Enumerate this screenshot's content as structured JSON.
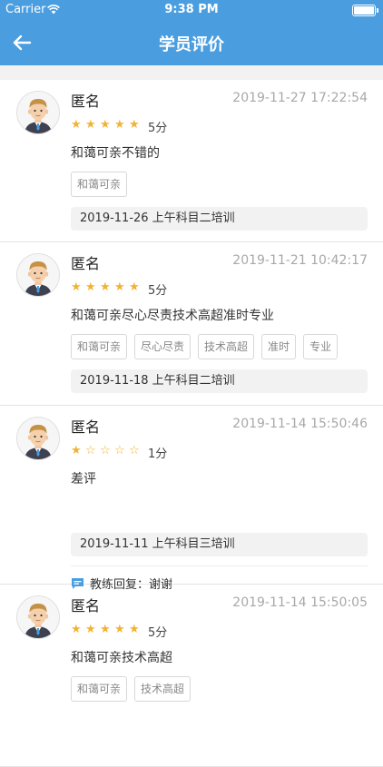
{
  "status_bar": {
    "carrier": "Carrier",
    "time": "9:38 PM"
  },
  "nav": {
    "title": "学员评价"
  },
  "reviews": [
    {
      "name": "匿名",
      "date": "2019-11-27 17:22:54",
      "rating": 5,
      "score_label": "5分",
      "comment": "和蔼可亲不错的",
      "tags": [
        "和蔼可亲"
      ],
      "session": "2019-11-26 上午科目二培训",
      "reply": null
    },
    {
      "name": "匿名",
      "date": "2019-11-21 10:42:17",
      "rating": 5,
      "score_label": "5分",
      "comment": "和蔼可亲尽心尽责技术高超准时专业",
      "tags": [
        "和蔼可亲",
        "尽心尽责",
        "技术高超",
        "准时",
        "专业"
      ],
      "session": "2019-11-18 上午科目二培训",
      "reply": null
    },
    {
      "name": "匿名",
      "date": "2019-11-14 15:50:46",
      "rating": 1,
      "score_label": "1分",
      "comment": "差评",
      "tags": [],
      "session": "2019-11-11 上午科目三培训",
      "reply": "教练回复：谢谢"
    },
    {
      "name": "匿名",
      "date": "2019-11-14 15:50:05",
      "rating": 5,
      "score_label": "5分",
      "comment": "和蔼可亲技术高超",
      "tags": [
        "和蔼可亲",
        "技术高超"
      ],
      "session": "",
      "reply": null
    }
  ],
  "colors": {
    "nav_bg": "#4a9ee0",
    "star": "#f2b233",
    "reply_icon": "#4a9ee0"
  },
  "icons": {
    "back": "arrow-left-icon",
    "avatar": "user-avatar-icon",
    "star_full": "star-filled-icon",
    "star_empty": "star-outline-icon",
    "reply": "chat-bubble-icon"
  }
}
